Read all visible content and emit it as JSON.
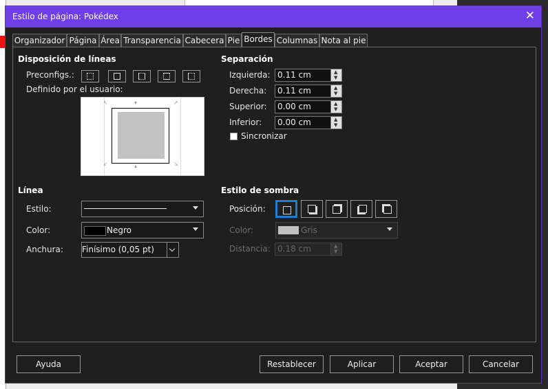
{
  "window": {
    "title": "Estilo de página: Pokédex",
    "close_glyph": "✕"
  },
  "tabs": [
    {
      "label": "Organizador"
    },
    {
      "label": "Página"
    },
    {
      "label": "Área"
    },
    {
      "label": "Transparencia"
    },
    {
      "label": "Cabecera"
    },
    {
      "label": "Pie"
    },
    {
      "label": "Bordes"
    },
    {
      "label": "Columnas"
    },
    {
      "label": "Nota al pie"
    }
  ],
  "active_tab": "Bordes",
  "line_arrangement": {
    "heading": "Disposición de líneas",
    "presets_label": "Preconfigs.:",
    "user_defined_label": "Definido por el usuario:"
  },
  "padding": {
    "heading": "Separación",
    "left_label": "Izquierda:",
    "left_value": "0.11 cm",
    "right_label": "Derecha:",
    "right_value": "0.11 cm",
    "top_label": "Superior:",
    "top_value": "0.00 cm",
    "bottom_label": "Inferior:",
    "bottom_value": "0.00 cm",
    "sync_label": "Sincronizar"
  },
  "line": {
    "heading": "Línea",
    "style_label": "Estilo:",
    "color_label": "Color:",
    "color_value": "Negro",
    "color_swatch": "#000000",
    "width_label": "Anchura:",
    "width_value": "Finísimo (0,05 pt)"
  },
  "shadow": {
    "heading": "Estilo de sombra",
    "position_label": "Posición:",
    "color_label": "Color:",
    "color_value": "Gris",
    "color_swatch": "#c0c0c0",
    "distance_label": "Distancia:",
    "distance_value": "0.18 cm"
  },
  "buttons": {
    "help": "Ayuda",
    "reset": "Restablecer",
    "apply": "Aplicar",
    "ok": "Aceptar",
    "cancel": "Cancelar"
  },
  "colors": {
    "titlebar": "#6e3fe6",
    "selected_outline": "#1e7ed4"
  }
}
